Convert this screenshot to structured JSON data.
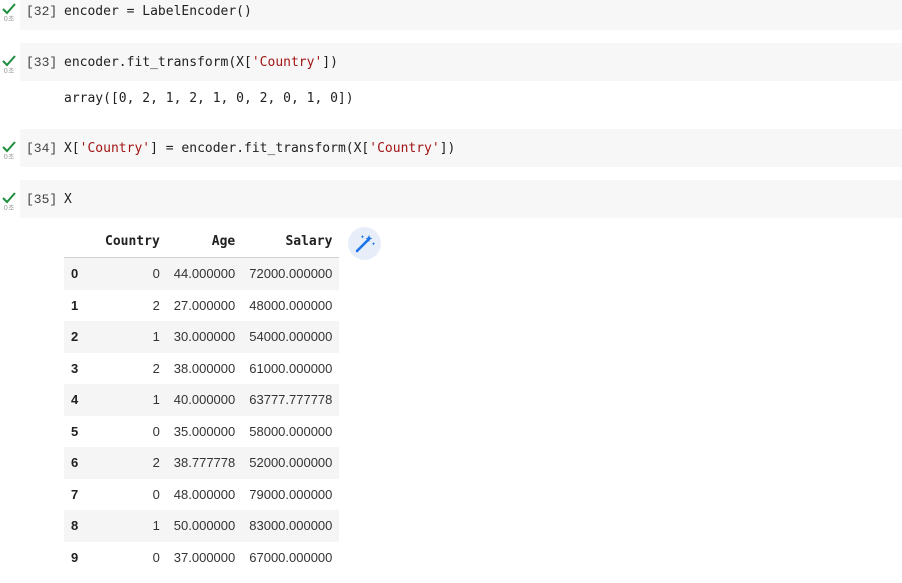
{
  "cells": [
    {
      "exec": "[32]",
      "time": "0초",
      "code": "encoder = LabelEncoder()"
    },
    {
      "exec": "[33]",
      "time": "0초",
      "code_pre": "encoder.fit_transform(X[",
      "code_str": "'Country'",
      "code_post": "])",
      "output": "array([0, 2, 1, 2, 1, 0, 2, 0, 1, 0])"
    },
    {
      "exec": "[34]",
      "time": "0초",
      "code_a": "X[",
      "code_str1": "'Country'",
      "code_b": "] = encoder.fit_transform(X[",
      "code_str2": "'Country'",
      "code_c": "])"
    },
    {
      "exec": "[35]",
      "time": "0초",
      "code": "X"
    }
  ],
  "dataframe": {
    "columns": [
      "",
      "Country",
      "Age",
      "Salary"
    ],
    "rows": [
      [
        "0",
        "0",
        "44.000000",
        "72000.000000"
      ],
      [
        "1",
        "2",
        "27.000000",
        "48000.000000"
      ],
      [
        "2",
        "1",
        "30.000000",
        "54000.000000"
      ],
      [
        "3",
        "2",
        "38.000000",
        "61000.000000"
      ],
      [
        "4",
        "1",
        "40.000000",
        "63777.777778"
      ],
      [
        "5",
        "0",
        "35.000000",
        "58000.000000"
      ],
      [
        "6",
        "2",
        "38.777778",
        "52000.000000"
      ],
      [
        "7",
        "0",
        "48.000000",
        "79000.000000"
      ],
      [
        "8",
        "1",
        "50.000000",
        "83000.000000"
      ],
      [
        "9",
        "0",
        "37.000000",
        "67000.000000"
      ]
    ]
  },
  "icons": {
    "status": "check-icon",
    "table_action": "magic-wand-icon"
  },
  "colors": {
    "check": "#1e8e3e",
    "string": "#a31515",
    "code_bg": "#f7f7f7",
    "wand_bg": "#e8eef9",
    "wand": "#1a73e8"
  }
}
